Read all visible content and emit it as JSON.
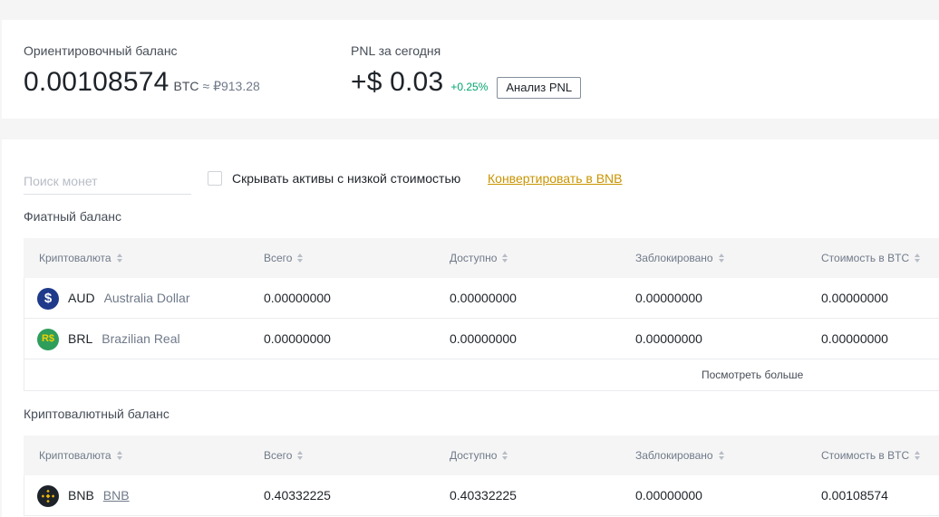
{
  "summary": {
    "balance_label": "Ориентировочный баланс",
    "balance_value": "0.00108574",
    "balance_unit": "BTC",
    "balance_fiat": "≈ ₽913.28",
    "pnl_label": "PNL за сегодня",
    "pnl_value": "+$ 0.03",
    "pnl_percent": "+0.25%",
    "pnl_button": "Анализ PNL"
  },
  "toolbar": {
    "search_placeholder": "Поиск монет",
    "hide_small_label": "Скрывать активы с низкой стоимостью",
    "convert_link": "Конвертировать в BNB"
  },
  "fiat": {
    "title": "Фиатный баланс",
    "columns": [
      "Криптовалюта",
      "Всего",
      "Доступно",
      "Заблокировано",
      "Стоимость в BTC"
    ],
    "rows": [
      {
        "symbol": "AUD",
        "name": "Australia Dollar",
        "icon": "dollar-icon",
        "total": "0.00000000",
        "available": "0.00000000",
        "locked": "0.00000000",
        "btc_value": "0.00000000"
      },
      {
        "symbol": "BRL",
        "name": "Brazilian Real",
        "icon": "real-icon",
        "total": "0.00000000",
        "available": "0.00000000",
        "locked": "0.00000000",
        "btc_value": "0.00000000"
      }
    ],
    "more_label": "Посмотреть больше"
  },
  "crypto": {
    "title": "Криптовалютный баланс",
    "columns": [
      "Криптовалюта",
      "Всего",
      "Доступно",
      "Заблокировано",
      "Стоимость в BTC"
    ],
    "rows": [
      {
        "symbol": "BNB",
        "name": "BNB",
        "icon": "bnb-icon",
        "total": "0.40332225",
        "available": "0.40332225",
        "locked": "0.00000000",
        "btc_value": "0.00108574"
      }
    ]
  },
  "colors": {
    "accent": "#c99400",
    "positive": "#03a66d",
    "aud_icon": "#1f3a8a",
    "brl_icon": "#2e9e5b",
    "bnb_icon": "#1e2329",
    "bnb_mark": "#f0b90b"
  }
}
